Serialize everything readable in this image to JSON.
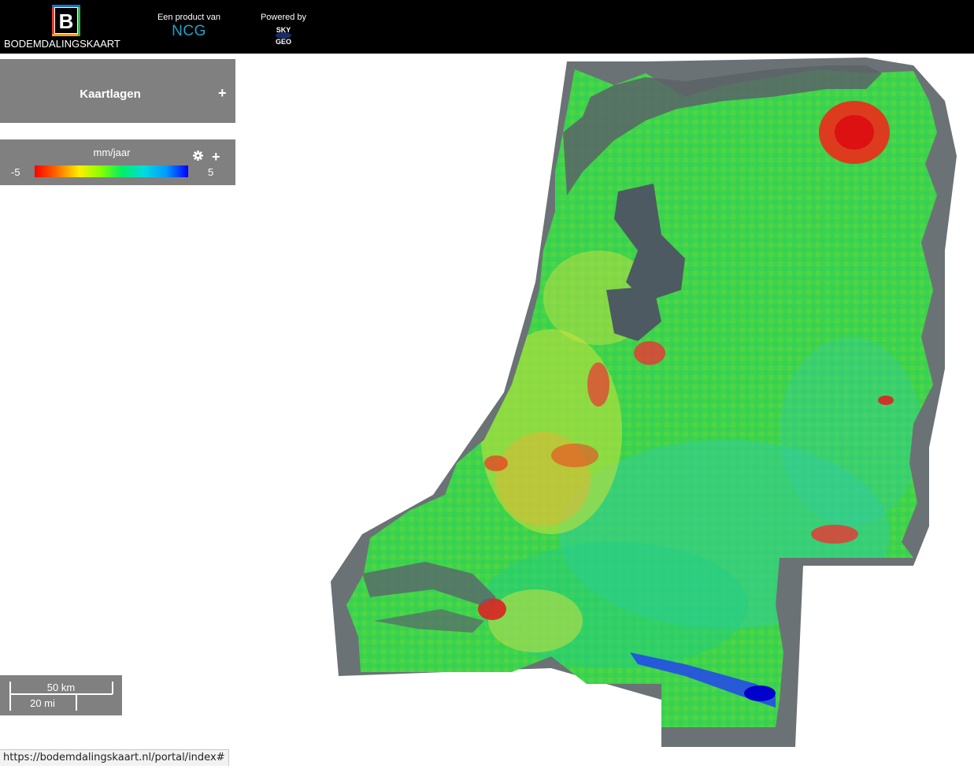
{
  "header": {
    "logo_letter": "B",
    "brand": "BODEMDALINGSKAART",
    "product_caption": "Een product van",
    "product_name": "NCG",
    "powered_caption": "Powered by",
    "powered_logo_text": [
      "SKY",
      "GEO"
    ]
  },
  "layers_panel": {
    "title": "Kaartlagen",
    "expand_label": "+"
  },
  "legend_panel": {
    "unit": "mm/jaar",
    "min": "-5",
    "max": "5",
    "expand_label": "+",
    "settings_icon": "gear-icon",
    "colors": [
      "#ff0000",
      "#ff6600",
      "#ffee00",
      "#88ff00",
      "#00ee66",
      "#00dddd",
      "#0099ff",
      "#0000ff"
    ]
  },
  "scale": {
    "metric": "50 km",
    "imperial": "20 mi"
  },
  "status_bar": {
    "url": "https://bodemdalingskaart.nl/portal/index#"
  },
  "map": {
    "description_icon": "subsidence-map-netherlands"
  }
}
